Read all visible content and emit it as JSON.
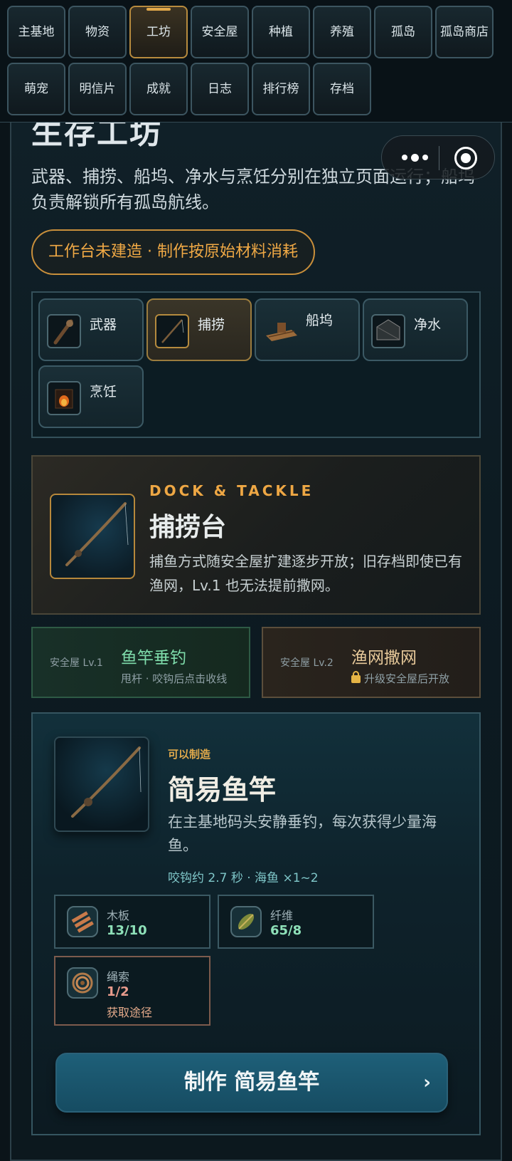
{
  "nav": {
    "tabs": [
      {
        "label": "主基地"
      },
      {
        "label": "物资"
      },
      {
        "label": "工坊",
        "active": true
      },
      {
        "label": "安全屋"
      },
      {
        "label": "种植"
      },
      {
        "label": "养殖"
      },
      {
        "label": "孤岛"
      },
      {
        "label": "孤岛商店"
      },
      {
        "label": "萌宠"
      },
      {
        "label": "明信片"
      },
      {
        "label": "成就"
      },
      {
        "label": "日志"
      },
      {
        "label": "排行榜"
      },
      {
        "label": "存档"
      }
    ]
  },
  "capsule": {
    "more_icon": "more-dots-icon",
    "close_icon": "target-circle-icon"
  },
  "page": {
    "title": "生存工坊",
    "description": "武器、捕捞、船坞、净水与烹饪分别在独立页面运行；船坞负责解锁所有孤岛航线。",
    "status_pill": "工作台未建造 · 制作按原始材料消耗"
  },
  "categories": [
    {
      "label": "武器",
      "icon": "club-icon"
    },
    {
      "label": "捕捞",
      "icon": "fishing-rod-icon",
      "active": true
    },
    {
      "label": "船坞",
      "icon": "raft-icon"
    },
    {
      "label": "净水",
      "icon": "water-still-icon"
    },
    {
      "label": "烹饪",
      "icon": "campfire-icon"
    }
  ],
  "hero": {
    "eyebrow": "DOCK & TACKLE",
    "title": "捕捞台",
    "description": "捕鱼方式随安全屋扩建逐步开放；旧存档即使已有渔网，Lv.1 也无法提前撒网。",
    "icon": "fishing-rod-icon"
  },
  "methods": [
    {
      "requirement": "安全屋 Lv.1",
      "title": "鱼竿垂钓",
      "subtitle": "甩杆 · 咬钩后点击收线"
    },
    {
      "requirement": "安全屋 Lv.2",
      "title": "渔网撒网",
      "subtitle": "升级安全屋后开放",
      "locked": true
    }
  ],
  "recipe": {
    "status": "可以制造",
    "title": "简易鱼竿",
    "description": "在主基地码头安静垂钓，每次获得少量海鱼。",
    "stats": "咬钩约 2.7 秒 · 海鱼 ×1~2",
    "materials": [
      {
        "name": "木板",
        "count": "13/10",
        "icon": "wood-planks-icon"
      },
      {
        "name": "纤维",
        "count": "65/8",
        "icon": "fiber-bundle-icon"
      },
      {
        "name": "绳索",
        "count": "1/2",
        "icon": "rope-coil-icon",
        "link": "获取途径"
      }
    ],
    "craft_button": "制作 简易鱼竿",
    "craft_chevron": "›"
  },
  "colors": {
    "accent_gold": "#e0a84a",
    "ok_green": "#8ee0b8",
    "short_red": "#e89b8c",
    "craft_blue": "#1e5f78"
  }
}
